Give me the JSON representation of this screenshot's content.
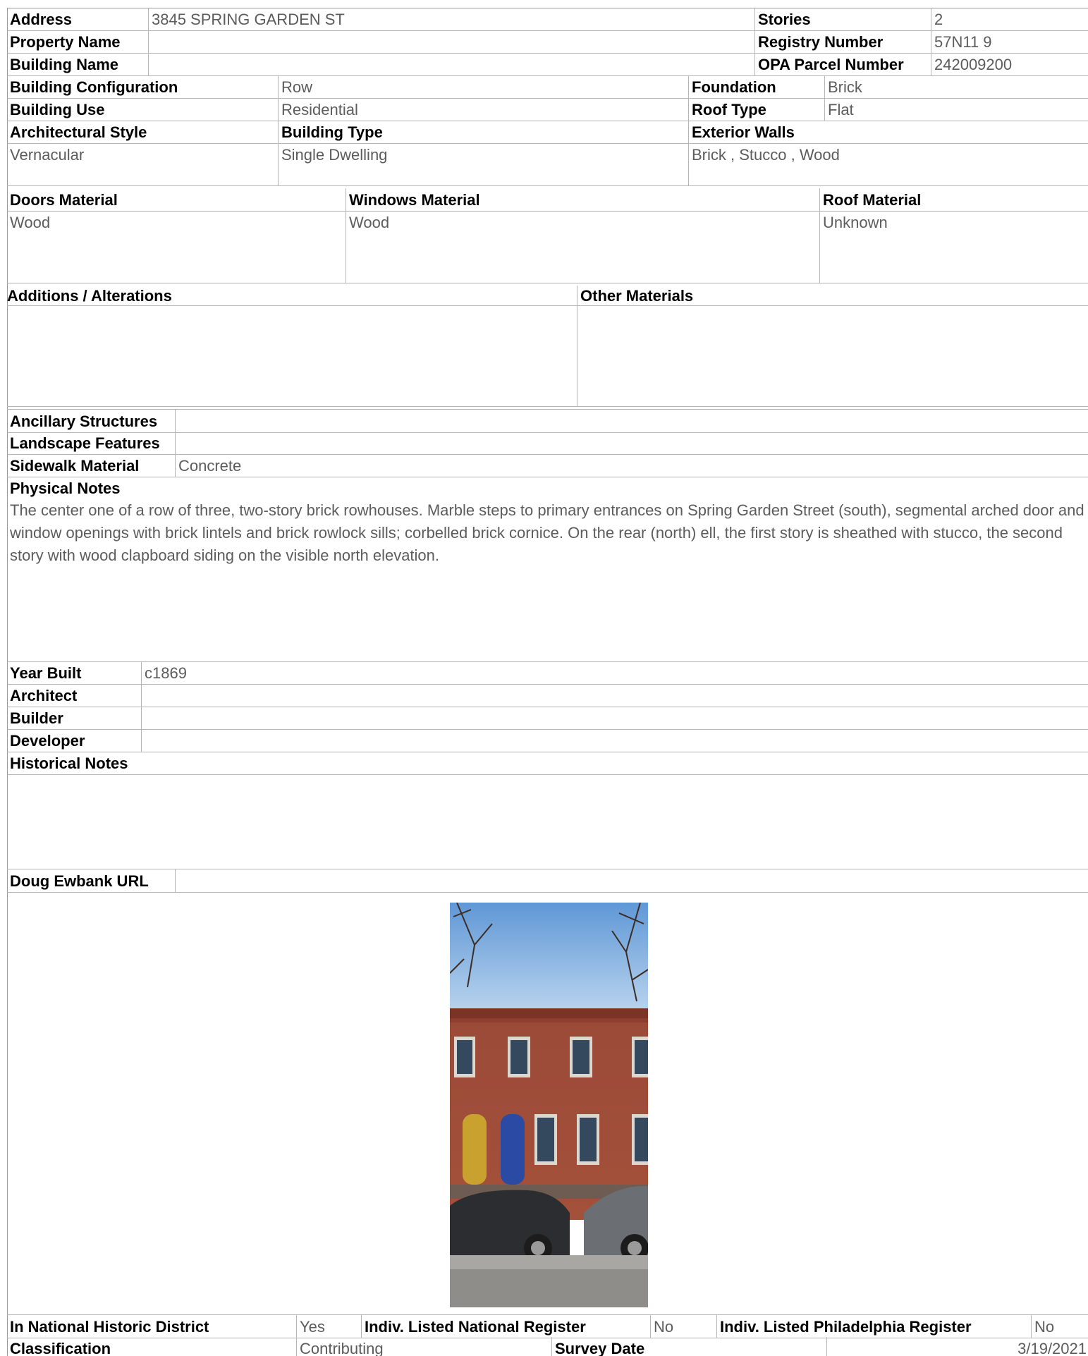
{
  "header": {
    "address_label": "Address",
    "address": "3845 SPRING GARDEN ST",
    "stories_label": "Stories",
    "stories": "2",
    "property_name_label": "Property Name",
    "property_name": "",
    "registry_number_label": "Registry Number",
    "registry_number": "57N11 9",
    "building_name_label": "Building Name",
    "building_name": "",
    "opa_parcel_number_label": "OPA Parcel Number",
    "opa_parcel_number": "242009200"
  },
  "building": {
    "configuration_label": "Building Configuration",
    "configuration": "Row",
    "foundation_label": "Foundation",
    "foundation": "Brick",
    "use_label": "Building Use",
    "use": "Residential",
    "roof_type_label": "Roof Type",
    "roof_type": "Flat",
    "architectural_style_label": "Architectural Style",
    "architectural_style": "Vernacular",
    "building_type_label": "Building Type",
    "building_type": "Single Dwelling",
    "exterior_walls_label": "Exterior Walls",
    "exterior_walls": "Brick , Stucco , Wood"
  },
  "materials": {
    "doors_label": "Doors Material",
    "doors": "Wood",
    "windows_label": "Windows Material",
    "windows": "Wood",
    "roof_label": "Roof Material",
    "roof": "Unknown",
    "additions_label": "Additions / Alterations",
    "additions": "",
    "other_label": "Other Materials",
    "other": ""
  },
  "site": {
    "ancillary_label": "Ancillary Structures",
    "ancillary": "",
    "landscape_label": "Landscape Features",
    "landscape": "",
    "sidewalk_label": "Sidewalk Material",
    "sidewalk": "Concrete"
  },
  "physical_notes": {
    "label": "Physical Notes",
    "text": "The center one of a row of three, two-story brick rowhouses. Marble steps to primary entrances on Spring Garden Street (south), segmental arched door and window openings with brick lintels and brick rowlock sills; corbelled brick cornice. On the rear (north) ell, the first story is sheathed with stucco, the second story with wood clapboard siding on the visible north elevation."
  },
  "history": {
    "year_built_label": "Year Built",
    "year_built": "c1869",
    "architect_label": "Architect",
    "architect": "",
    "builder_label": "Builder",
    "builder": "",
    "developer_label": "Developer",
    "developer": "",
    "notes_label": "Historical Notes",
    "notes": ""
  },
  "url": {
    "label": "Doug Ewbank URL",
    "value": ""
  },
  "status": {
    "national_district_label": "In National Historic District",
    "national_district": "Yes",
    "national_register_label": "Indiv. Listed National Register",
    "national_register": "No",
    "philadelphia_register_label": "Indiv. Listed Philadelphia Register",
    "philadelphia_register": "No",
    "classification_label": "Classification",
    "classification": "Contributing",
    "survey_date_label": "Survey Date",
    "survey_date": "3/19/2021"
  },
  "photo": {
    "icon": "building-photo"
  },
  "colors": {
    "label": "#000000",
    "value": "#5c5c5c",
    "rule": "#b5b5b5"
  }
}
